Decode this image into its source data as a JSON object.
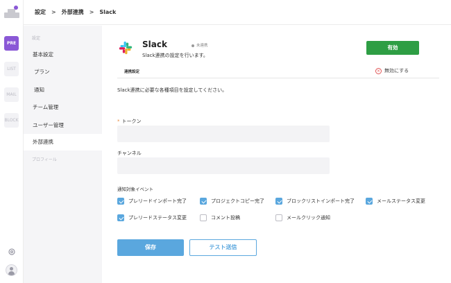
{
  "rail": {
    "items": [
      "PRE",
      "LIST",
      "MAIL",
      "BLOCK"
    ]
  },
  "breadcrumb": {
    "items": [
      "設定",
      "外部連携",
      "Slack"
    ],
    "separator": ">"
  },
  "sidebar": {
    "section_settings": "設定",
    "items": [
      "基本設定",
      "プラン",
      "通知",
      "チーム管理",
      "ユーザー管理",
      "外部連携"
    ],
    "section_profile": "プロフィール",
    "active": "外部連携"
  },
  "integration": {
    "name": "Slack",
    "status": "未連携",
    "description": "Slack連携の設定を行います。",
    "enable_label": "有効",
    "tab_label": "連携設定",
    "disable_label": "無効にする",
    "intro": "Slack連携に必要な各種項目を設定してください。"
  },
  "form": {
    "token_label": "トークン",
    "token_value": "",
    "channel_label": "チャンネル",
    "channel_value": "",
    "events_label": "通知対象イベント",
    "events": [
      {
        "label": "プレリードインポート完了",
        "checked": true
      },
      {
        "label": "プロジェクトコピー完了",
        "checked": true
      },
      {
        "label": "ブロックリストインポート完了",
        "checked": true
      },
      {
        "label": "メールステータス変更",
        "checked": true
      },
      {
        "label": "プレリードステータス変更",
        "checked": true
      },
      {
        "label": "コメント投稿",
        "checked": false
      },
      {
        "label": "メールクリック通知",
        "checked": false
      }
    ],
    "save_label": "保存",
    "test_label": "テスト送信"
  },
  "colors": {
    "brand_purple": "#8a58d6",
    "enable_green": "#2e9e44",
    "primary_blue": "#5aa7de",
    "required_orange": "#e8893a"
  }
}
